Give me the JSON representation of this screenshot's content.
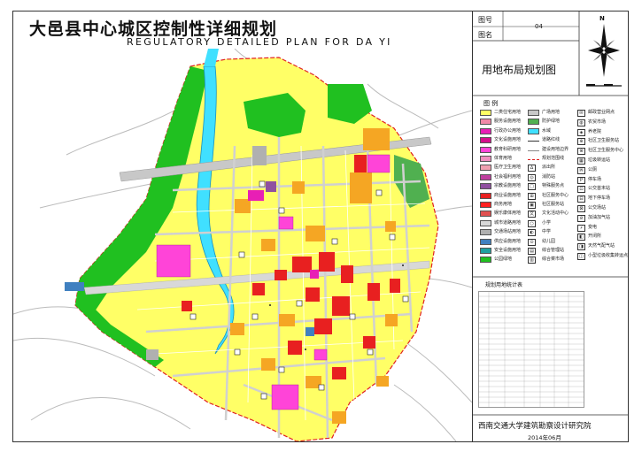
{
  "title": {
    "cn": "大邑县中心城区控制性详细规划",
    "en": "Regulatory Detailed Plan for Da Yi"
  },
  "info": {
    "drawing_no_label": "图号",
    "drawing_name_label": "图名",
    "drawing_no": "04",
    "drawing_name": "用地布局规划图"
  },
  "compass": {
    "north": "N"
  },
  "legend": {
    "title": "图 例",
    "landuse": [
      {
        "label": "二类住宅用地",
        "color": "#ffff66"
      },
      {
        "label": "服务设施用地",
        "color": "#f08aa8"
      },
      {
        "label": "行政办公用地",
        "color": "#e81fb5"
      },
      {
        "label": "文化设施用地",
        "color": "#d40f8c"
      },
      {
        "label": "教育科研用地",
        "color": "#ff44d8"
      },
      {
        "label": "体育用地",
        "color": "#f090c0"
      },
      {
        "label": "医疗卫生用地",
        "color": "#f0a0b0"
      },
      {
        "label": "社会福利用地",
        "color": "#c040a0"
      },
      {
        "label": "宗教设施用地",
        "color": "#9050a0"
      },
      {
        "label": "商业设施用地",
        "color": "#e82020"
      },
      {
        "label": "商务用地",
        "color": "#ff2020"
      },
      {
        "label": "娱乐康体用地",
        "color": "#e05050"
      },
      {
        "label": "城市道路用地",
        "color": "#d8d8d8"
      },
      {
        "label": "交通场站用地",
        "color": "#b0b0b0"
      },
      {
        "label": "供应设施用地",
        "color": "#4080c0"
      },
      {
        "label": "安全设施用地",
        "color": "#20a0a0"
      },
      {
        "label": "公园绿地",
        "color": "#20c020"
      }
    ],
    "other": [
      {
        "label": "广场用地",
        "type": "swatch",
        "color": "#c8c8c8"
      },
      {
        "label": "防护绿地",
        "type": "swatch",
        "color": "#50b050"
      },
      {
        "label": "水域",
        "type": "swatch",
        "color": "#40e0ff"
      },
      {
        "label": "道路红线",
        "type": "line",
        "color": "#333333"
      },
      {
        "label": "建设用地边界",
        "type": "line",
        "color": "#888888"
      },
      {
        "label": "规划范围线",
        "type": "dash",
        "color": "#e02020"
      },
      {
        "label": "派出所",
        "type": "box",
        "glyph": "∆"
      },
      {
        "label": "消防站",
        "type": "box",
        "glyph": "◎"
      },
      {
        "label": "特殊服务点",
        "type": "box",
        "glyph": "□"
      },
      {
        "label": "社区服务中心",
        "type": "box",
        "glyph": "⊞"
      },
      {
        "label": "社区服务站",
        "type": "box",
        "glyph": "▣"
      },
      {
        "label": "文化活动中心",
        "type": "box",
        "glyph": "文"
      },
      {
        "label": "小学",
        "type": "box",
        "glyph": "○"
      },
      {
        "label": "中学",
        "type": "box",
        "glyph": "◐"
      },
      {
        "label": "幼儿园",
        "type": "box",
        "glyph": "⊙"
      },
      {
        "label": "综合管理站",
        "type": "box",
        "glyph": "▤"
      },
      {
        "label": "综合菜市场",
        "type": "box",
        "glyph": "▥"
      }
    ],
    "other2": [
      {
        "label": "邮政营业网点",
        "glyph": "✉"
      },
      {
        "label": "农贸市场",
        "glyph": "◍"
      },
      {
        "label": "养老院",
        "glyph": "◈"
      },
      {
        "label": "社区卫生服务站",
        "glyph": "⊕"
      },
      {
        "label": "社区卫生服务中心",
        "glyph": "⊗"
      },
      {
        "label": "垃圾转运站",
        "glyph": "▦"
      },
      {
        "label": "公厕",
        "glyph": "Ⓦ"
      },
      {
        "label": "停车场",
        "glyph": "P"
      },
      {
        "label": "公交首末站",
        "glyph": "⊡"
      },
      {
        "label": "地下停车场",
        "glyph": "⊟"
      },
      {
        "label": "公交场站",
        "glyph": "⊠"
      },
      {
        "label": "加油加气站",
        "glyph": "⊘"
      },
      {
        "label": "变电",
        "glyph": "⚡"
      },
      {
        "label": "开闭所",
        "glyph": "◧"
      },
      {
        "label": "天然气配气站",
        "glyph": "◨"
      },
      {
        "label": "小型垃圾收集转运点",
        "glyph": "◫"
      }
    ]
  },
  "table": {
    "title": "规划用地统计表"
  },
  "footer": {
    "org": "西南交通大学建筑勘察设计研究院",
    "date": "2014年06月"
  },
  "colors": {
    "residential": "#ffff66",
    "commercial": "#e82020",
    "education": "#ff44d8",
    "greenspace": "#20c020",
    "water": "#40e0ff",
    "road": "#d8d8d8",
    "boundary": "#e02020"
  }
}
